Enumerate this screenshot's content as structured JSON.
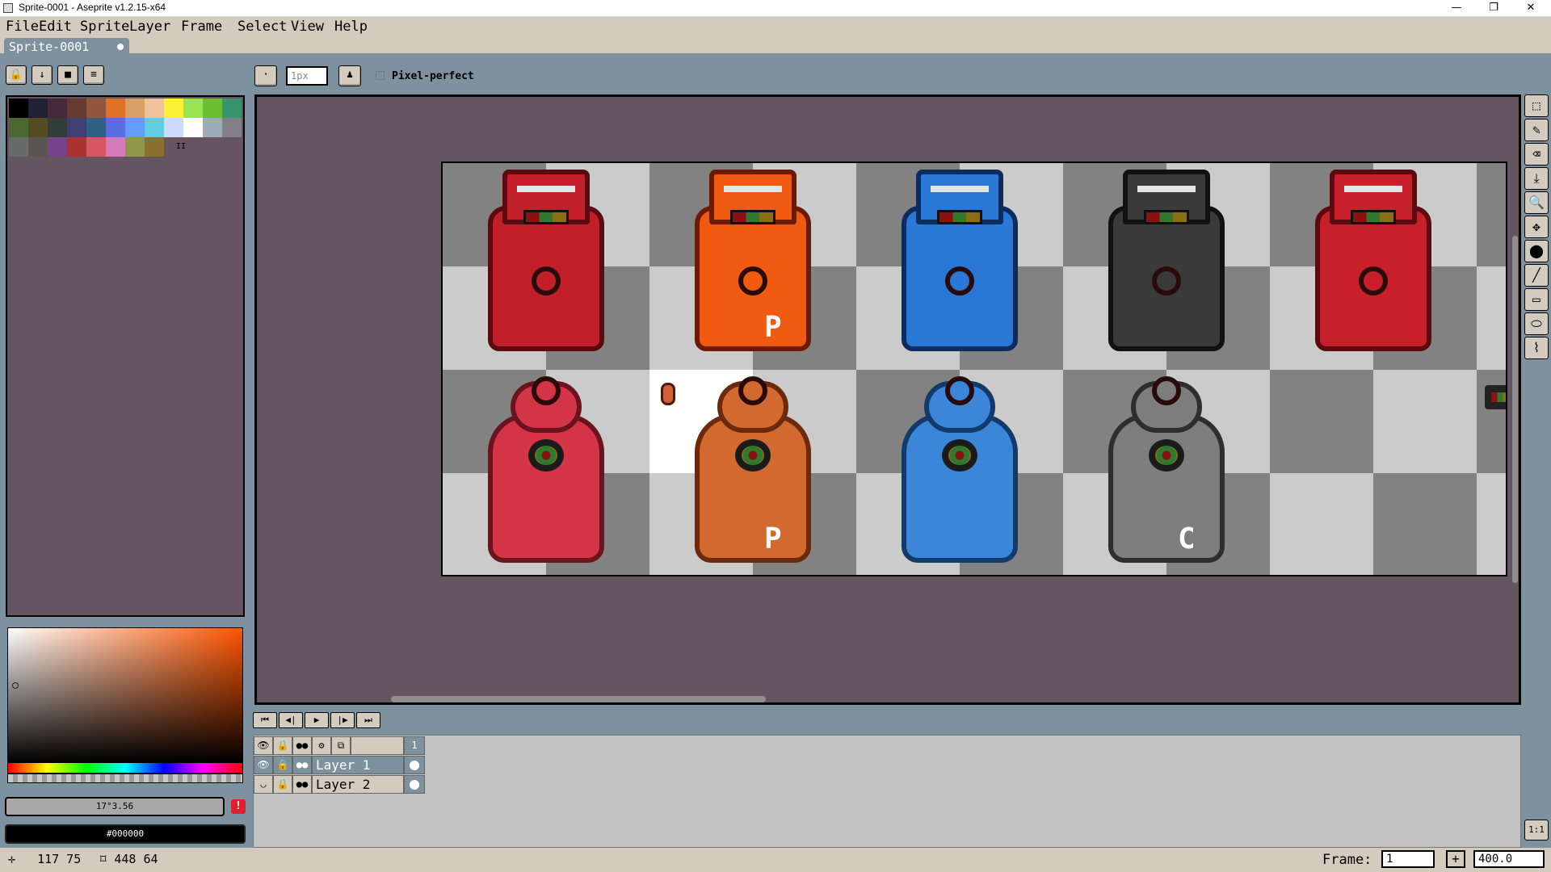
{
  "window": {
    "title": "Sprite-0001 - Aseprite v1.2.15-x64",
    "min_icon": "—",
    "max_icon": "❐",
    "close_icon": "✕"
  },
  "menu": [
    "File",
    "Edit",
    "Sprite",
    "Layer",
    "Frame",
    "Select",
    "View",
    "Help"
  ],
  "tab": {
    "label": "Sprite-0001"
  },
  "left_toolbar": [
    "lock-icon",
    "down-arrow-icon",
    "stop-icon",
    "menu-icon"
  ],
  "context_bar": {
    "brush_size_value": "",
    "brush_size_placeholder": "1px",
    "pixel_perfect_label": "Pixel-perfect",
    "pixel_perfect_checked": false
  },
  "palette": {
    "colors": [
      "#000000",
      "#222034",
      "#45283c",
      "#663931",
      "#8f563b",
      "#df7126",
      "#d9a066",
      "#eec39a",
      "#fbf236",
      "#99e550",
      "#6abe30",
      "#37946e",
      "#4b692f",
      "#524b24",
      "#323c39",
      "#3f3f74",
      "#306082",
      "#5b6ee1",
      "#639bff",
      "#5fcde4",
      "#cbdbfc",
      "#ffffff",
      "#9badb7",
      "#847e87",
      "#696a6a",
      "#595652",
      "#76428a",
      "#ac3232",
      "#d95763",
      "#d77bba",
      "#8f974a",
      "#8a6f30"
    ],
    "resize_handle": "II"
  },
  "color_picker": {
    "hue_field": "17°3.56",
    "hex_field": "#000000",
    "warning_label": "!"
  },
  "sprites": {
    "top_row": [
      {
        "color": "#c21f2a",
        "edge": "#5b0a10",
        "letter": ""
      },
      {
        "color": "#f05a10",
        "edge": "#6a1a05",
        "letter": "P"
      },
      {
        "color": "#2a78d6",
        "edge": "#0b2c5c",
        "letter": ""
      },
      {
        "color": "#3a3a3a",
        "edge": "#111111",
        "letter": ""
      },
      {
        "color": "#c8202a",
        "edge": "#5b0a10",
        "letter": ""
      }
    ],
    "bottom_row": [
      {
        "color": "#d33446",
        "edge": "#6a1420",
        "letter": ""
      },
      {
        "color": "#d2692e",
        "edge": "#6a2a0b",
        "letter": "P"
      },
      {
        "color": "#3b86d8",
        "edge": "#123a6a",
        "letter": ""
      },
      {
        "color": "#7d7d7d",
        "edge": "#2e2e2e",
        "letter": "C"
      }
    ]
  },
  "right_tools": [
    "rectangle-marquee-icon",
    "pencil-icon",
    "eraser-icon",
    "eyedropper-icon",
    "zoom-icon",
    "move-icon",
    "paint-bucket-icon",
    "line-icon",
    "rectangle-icon",
    "ellipse-icon",
    "spray-icon"
  ],
  "right_tool_glyphs": [
    "⬚",
    "✎",
    "⌫",
    "⤓",
    "🔍",
    "✥",
    "⬤",
    "╱",
    "▭",
    "⬭",
    "⌇"
  ],
  "anim_controls": [
    "⏮",
    "◀|",
    "▶",
    "|▶",
    "⏭"
  ],
  "timeline": {
    "frame_number": "1",
    "layers": [
      {
        "name": "Layer 1",
        "visible": true,
        "selected": true
      },
      {
        "name": "Layer 2",
        "visible": false,
        "selected": false
      }
    ]
  },
  "one_to_one_label": "1:1",
  "status": {
    "cursor_pos": "117 75",
    "selection_size": "448 64",
    "frame_label": "Frame:",
    "frame_value": "1",
    "add_frame": "+",
    "zoom": "400.0"
  }
}
